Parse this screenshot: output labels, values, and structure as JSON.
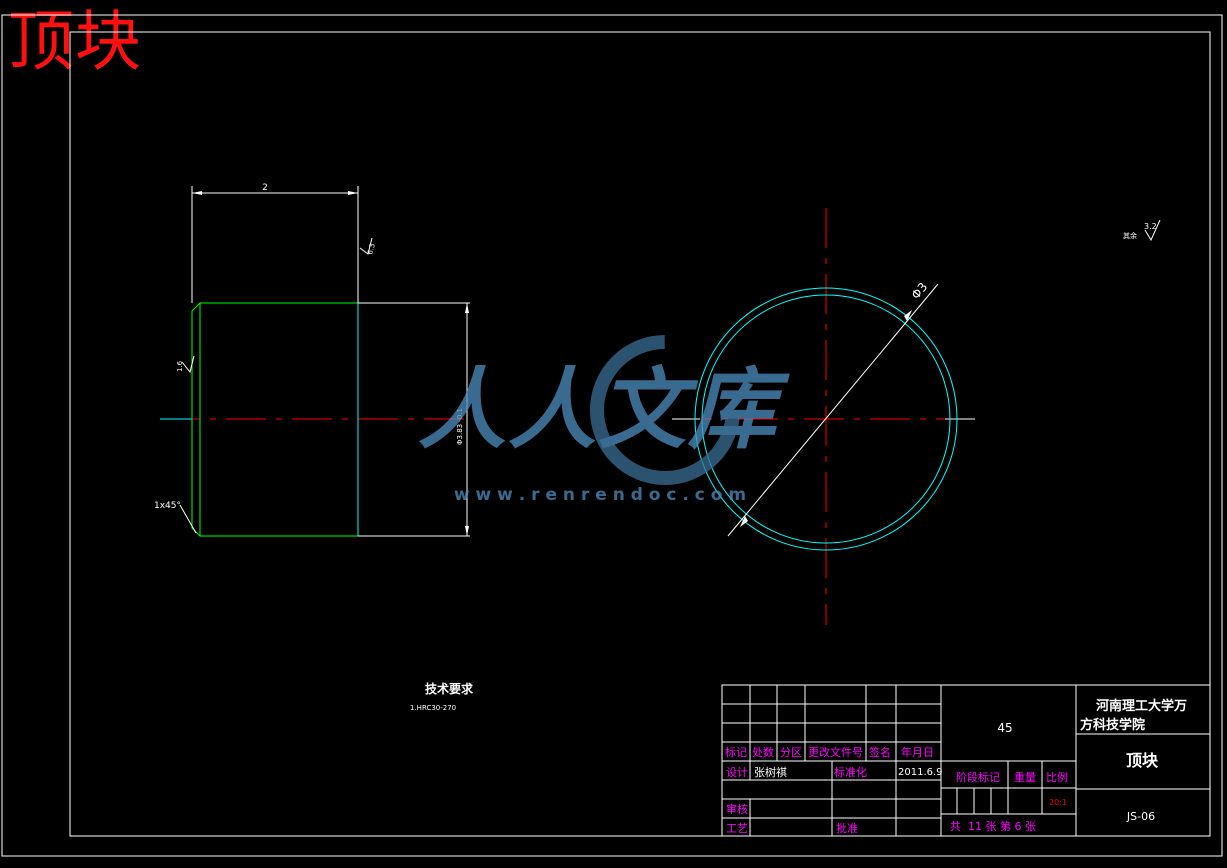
{
  "title": "顶块",
  "watermark": {
    "brand": "人人文库",
    "url": "w w w . r e n r e n d o c . c o m"
  },
  "roughness": {
    "label": "其余",
    "value": "3.2"
  },
  "front_view": {
    "dim_length": "2",
    "dim_diameter": "Φ3.83 -0.1",
    "chamfer_label": "1x45°",
    "roughness_left": "1.6",
    "roughness_top": "6.3"
  },
  "side_view": {
    "dim_diameter": "Φ3"
  },
  "tech_req": {
    "heading": "技术要求",
    "line1": "1.HRC30-270"
  },
  "title_block": {
    "material": "45",
    "school_line1": "河南理工大学万",
    "school_line2": "方科技学院",
    "part_name": "顶块",
    "drawing_no": "JS-06",
    "scale": "20:1",
    "header_mark": "标记",
    "header_count": "处数",
    "header_zone": "分区",
    "header_doc": "更改文件号",
    "header_sign": "签名",
    "header_date": "年月日",
    "designer_label": "设计",
    "designer_name": "张树祺",
    "standardize": "标准化",
    "design_date": "2011.6.9",
    "stage_mark": "阶段标记",
    "weight": "重量",
    "ratio": "比例",
    "review": "审核",
    "process": "工艺",
    "approve": "批准",
    "sheet_info": "共  11 张 第 6 张"
  },
  "colors": {
    "frame": "#ffffff",
    "green": "#00ff00",
    "cyan": "#00ffff",
    "red": "#ff0000",
    "magenta": "#ff00ff",
    "watermark": "#5aa6d6"
  }
}
